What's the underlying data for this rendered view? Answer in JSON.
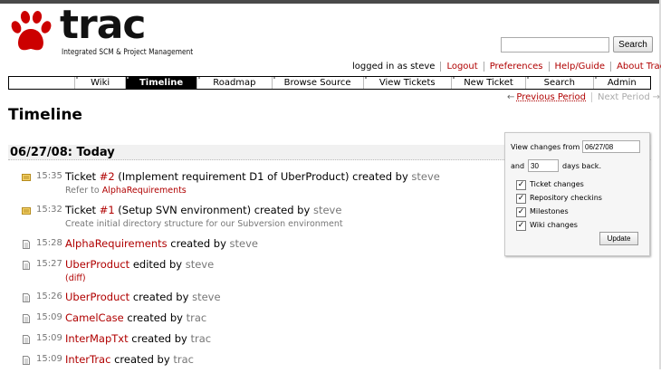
{
  "logo": {
    "word": "trac",
    "subtitle": "Integrated SCM & Project Management"
  },
  "search": {
    "value": "",
    "button": "Search"
  },
  "metanav": {
    "logged_in": "logged in as steve",
    "logout": "Logout",
    "preferences": "Preferences",
    "help": "Help/Guide",
    "about": "About Trac"
  },
  "mainnav": [
    {
      "label": ""
    },
    {
      "label": "Wiki"
    },
    {
      "label": "Timeline"
    },
    {
      "label": "Roadmap"
    },
    {
      "label": "Browse Source"
    },
    {
      "label": "View Tickets"
    },
    {
      "label": "New Ticket"
    },
    {
      "label": "Search"
    },
    {
      "label": "Admin"
    }
  ],
  "ctxnav": {
    "prev": "Previous Period",
    "next": "Next Period",
    "prev_arrow": "←",
    "next_arrow": "→"
  },
  "page_title": "Timeline",
  "day": "06/27/08: Today",
  "prefs": {
    "from_label": "View changes from",
    "from_value": "06/27/08",
    "and_label": "and",
    "days_value": "30",
    "days_label": "days back.",
    "filters": [
      "Ticket changes",
      "Repository checkins",
      "Milestones",
      "Wiki changes"
    ],
    "check": "✓",
    "update": "Update"
  },
  "events": [
    {
      "type": "ticket",
      "time": "15:35",
      "pre": "Ticket ",
      "link": "#2",
      "mid": " (Implement requirement D1 of UberProduct) created by ",
      "author": "steve",
      "desc_pre": "Refer to ",
      "desc_link": "AlphaRequirements"
    },
    {
      "type": "ticket",
      "time": "15:32",
      "pre": "Ticket ",
      "link": "#1",
      "mid": " (Setup SVN environment) created by ",
      "author": "steve",
      "desc_pre": "Create initial directory structure for our Subversion environment",
      "desc_link": ""
    },
    {
      "type": "wiki",
      "time": "15:28",
      "pre": "",
      "link": "AlphaRequirements",
      "mid": " created by ",
      "author": "steve",
      "desc_pre": "",
      "desc_link": ""
    },
    {
      "type": "wiki",
      "time": "15:27",
      "pre": "",
      "link": "UberProduct",
      "mid": " edited by ",
      "author": "steve",
      "desc_pre": "",
      "desc_link": "(diff)"
    },
    {
      "type": "wiki",
      "time": "15:26",
      "pre": "",
      "link": "UberProduct",
      "mid": " created by ",
      "author": "steve",
      "desc_pre": "",
      "desc_link": ""
    },
    {
      "type": "wiki",
      "time": "15:09",
      "pre": "",
      "link": "CamelCase",
      "mid": " created by ",
      "author": "trac",
      "desc_pre": "",
      "desc_link": ""
    },
    {
      "type": "wiki",
      "time": "15:09",
      "pre": "",
      "link": "InterMapTxt",
      "mid": " created by ",
      "author": "trac",
      "desc_pre": "",
      "desc_link": ""
    },
    {
      "type": "wiki",
      "time": "15:09",
      "pre": "",
      "link": "InterTrac",
      "mid": " created by ",
      "author": "trac",
      "desc_pre": "",
      "desc_link": ""
    }
  ]
}
